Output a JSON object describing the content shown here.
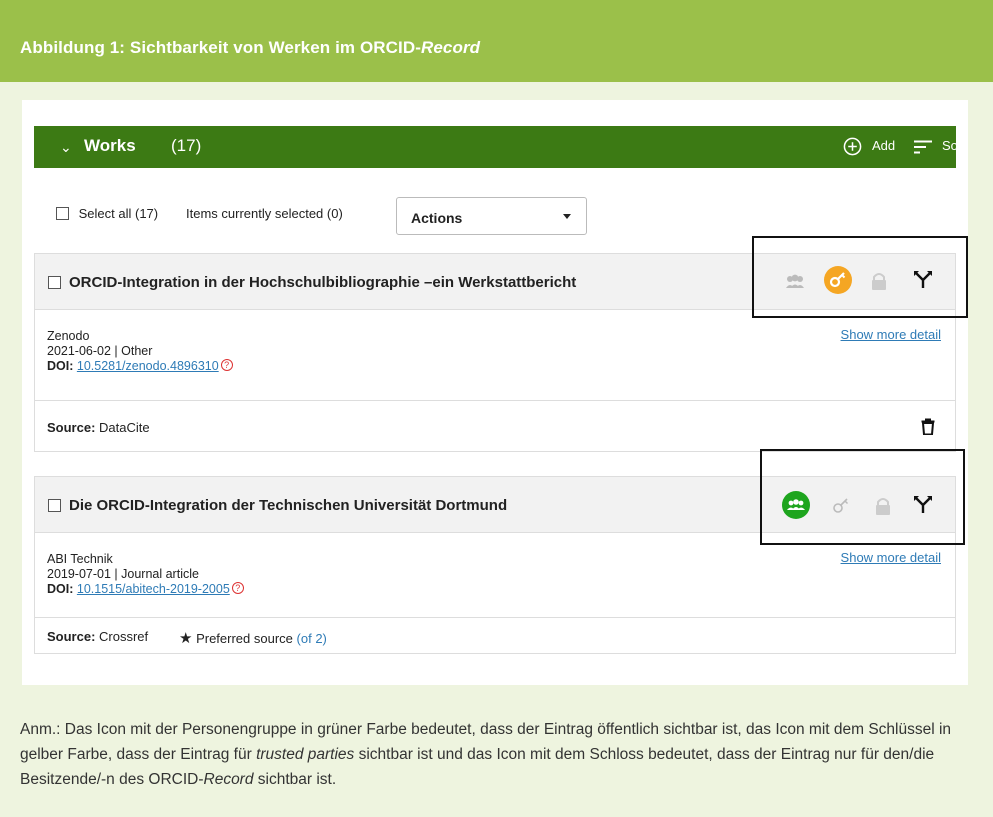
{
  "figure": {
    "title_prefix": "Abbildung 1: Sichtbarkeit von Werken im ORCID-",
    "title_italic": "Record"
  },
  "works_bar": {
    "title": "Works",
    "count": "(17)",
    "add_label": "Add",
    "sort_label": "Sort"
  },
  "toolbar": {
    "select_all": "Select all (17)",
    "items_selected": "Items currently selected (0)",
    "actions_label": "Actions"
  },
  "works": [
    {
      "title": "ORCID-Integration in der Hochschulbibliographie –ein Werkstattbericht",
      "journal": "Zenodo",
      "date_type": "2021-06-02 | Other",
      "doi_label": "DOI:",
      "doi": "10.5281/zenodo.4896310",
      "show_more": "Show more detail",
      "source_label": "Source:",
      "source": "DataCite",
      "visibility": "trusted-parties"
    },
    {
      "title": "Die ORCID-Integration der Technischen Universität Dortmund",
      "journal": "ABI Technik",
      "date_type": "2019-07-01 | Journal article",
      "doi_label": "DOI:",
      "doi": "10.1515/abitech-2019-2005",
      "show_more": "Show more detail",
      "source_label": "Source:",
      "source": "Crossref",
      "preferred_source": "Preferred source",
      "preferred_of": "(of 2)",
      "visibility": "public"
    }
  ],
  "colors": {
    "header_green": "#9bc04a",
    "works_bar_green": "#3c7a14",
    "public_green": "#1ea51e",
    "trusted_orange": "#f5a623",
    "link_blue": "#2e7bb6"
  },
  "note": {
    "part1": "Anm.: Das Icon mit der Personengruppe in grüner Farbe bedeutet, dass der Eintrag öffentlich sichtbar ist, das Icon mit dem Schlüssel in gelber Farbe, dass der Eintrag für ",
    "italic1": "trusted parties",
    "part2": " sichtbar ist und das Icon mit dem Schloss bedeutet, dass der Eintrag nur für den/die Besitzende/-n des ORCID-",
    "italic2": "Record",
    "part3": " sichtbar ist."
  }
}
